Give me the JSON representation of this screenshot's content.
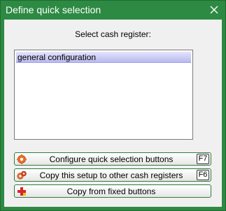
{
  "window": {
    "title": "Define quick selection",
    "colors": {
      "titlebar": "#2d8a43",
      "client": "#f0f0f0",
      "selection": "#c4c4f4"
    }
  },
  "prompt": "Select cash register:",
  "list": {
    "items": [
      {
        "label": "general configuration",
        "selected": true
      }
    ]
  },
  "buttons": [
    {
      "label": "Configure quick selection buttons",
      "shortcut": "F7",
      "icon": "gear-icon"
    },
    {
      "label": "Copy this setup to other cash registers",
      "shortcut": "F6",
      "icon": "copy-gears-icon"
    },
    {
      "label": "Copy from fixed buttons",
      "shortcut": "",
      "icon": "red-cross-icon"
    }
  ]
}
